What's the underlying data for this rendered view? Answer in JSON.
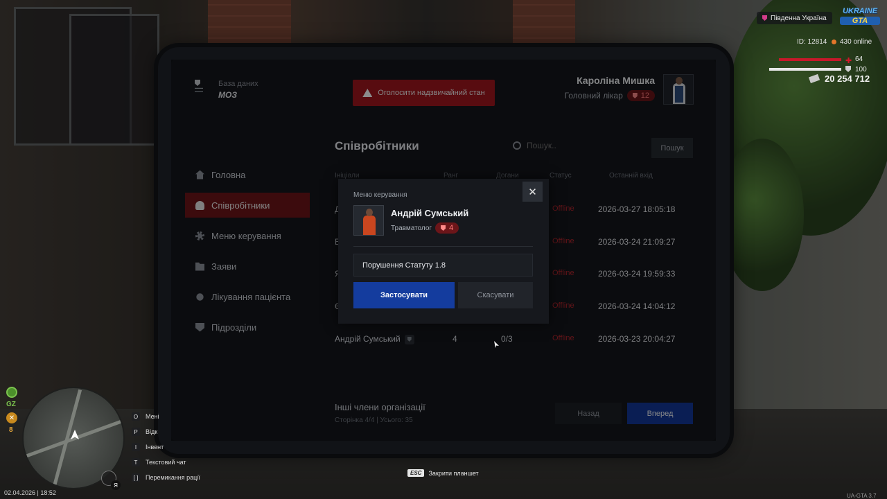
{
  "app": {
    "logo_subtitle": "База даних",
    "logo_title": "МОЗ",
    "emergency_label": "Оголосити надзвичайний стан"
  },
  "profile": {
    "name": "Кароліна Мишка",
    "role": "Головний лікар",
    "rank": "12"
  },
  "nav": {
    "items": [
      {
        "label": "Головна",
        "icon": "home-icon"
      },
      {
        "label": "Співробітники",
        "icon": "users-icon",
        "active": true
      },
      {
        "label": "Меню керування",
        "icon": "gear-icon"
      },
      {
        "label": "Заяви",
        "icon": "folder-icon"
      },
      {
        "label": "Лікування пацієнта",
        "icon": "sun-icon"
      },
      {
        "label": "Підрозділи",
        "icon": "shield-icon"
      }
    ]
  },
  "employees": {
    "title": "Співробітники",
    "search_placeholder": "Пошук..",
    "search_button": "Пошук",
    "columns": {
      "name": "Ініціали",
      "rank": "Ранг",
      "warnings": "Догани",
      "status": "Статус",
      "last_login": "Останній вхід"
    },
    "rows": [
      {
        "name": "Д",
        "rank": "",
        "warnings": "",
        "status": "Offline",
        "last_login": "2026-03-27 18:05:18"
      },
      {
        "name": "В",
        "rank": "",
        "warnings": "",
        "status": "Offline",
        "last_login": "2026-03-24 21:09:27"
      },
      {
        "name": "Я",
        "rank": "",
        "warnings": "",
        "status": "Offline",
        "last_login": "2026-03-24 19:59:33"
      },
      {
        "name": "Є",
        "rank": "",
        "warnings": "",
        "status": "Offline",
        "last_login": "2026-03-24 14:04:12"
      },
      {
        "name": "Андрій Сумський",
        "rank": "4",
        "warnings": "0/3",
        "status": "Offline",
        "last_login": "2026-03-23 20:04:27"
      }
    ],
    "footer_title": "Інші члени організації",
    "footer_sub": "Сторінка 4/4 | Усього: 35",
    "back_label": "Назад",
    "next_label": "Вперед"
  },
  "modal": {
    "title": "Меню керування",
    "close_symbol": "✕",
    "person_name": "Андрій Сумський",
    "person_role": "Травматолог",
    "person_rank": "4",
    "input_value": "Порушення Статуту 1.8",
    "apply_label": "Застосувати",
    "cancel_label": "Скасувати"
  },
  "hud": {
    "region": "Південна Україна",
    "logo_top": "UKRAINE",
    "logo_bottom": "GTA",
    "player_id": "ID: 12814",
    "online": "430 online",
    "health": "64",
    "armor": "100",
    "money": "20 254 712",
    "gz": "GZ",
    "x_value": "8",
    "datetime": "02.04.2026 | 18:52",
    "version": "UA-GTA 3.7",
    "mic_badge": "Я",
    "esc_key": "ESC",
    "esc_hint": "Закрити планшет",
    "keys": [
      {
        "key": "O",
        "label": "Мені"
      },
      {
        "key": "P",
        "label": "Відк"
      },
      {
        "key": "I",
        "label": "Інвент"
      },
      {
        "key": "T",
        "label": "Текстовий чат"
      },
      {
        "key": "[ ]",
        "label": "Перемикання рації"
      }
    ],
    "colors": {
      "accent_red": "#a1161e",
      "accent_blue": "#143c9e",
      "status_offline": "#b3262d"
    }
  }
}
